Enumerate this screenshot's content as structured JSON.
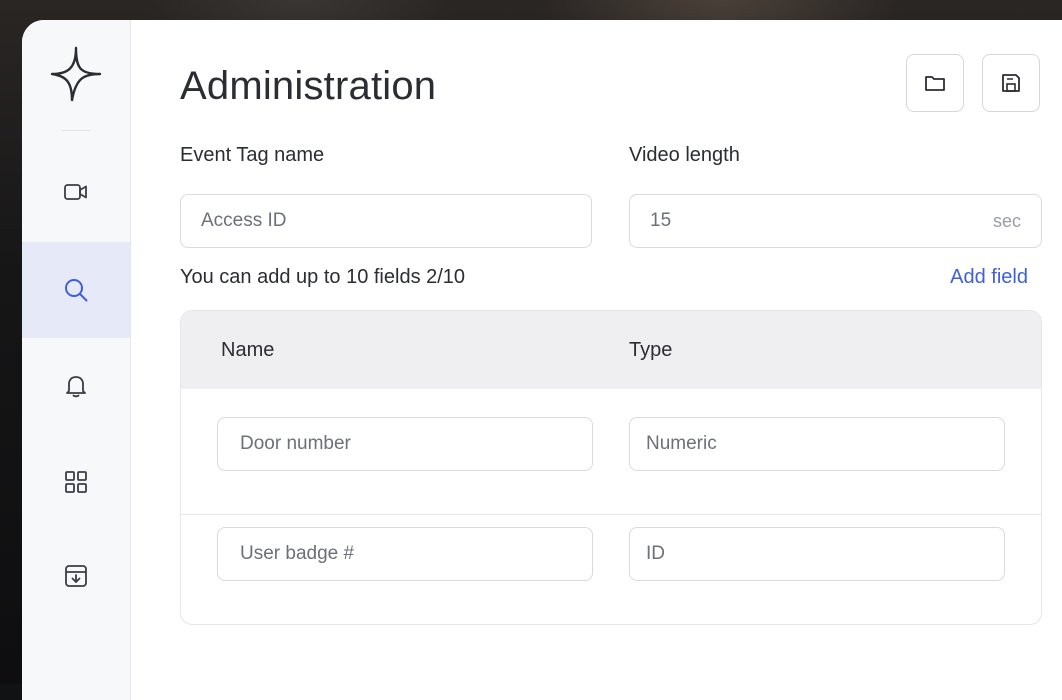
{
  "sidebar": {
    "logo_icon": "sparkle-logo",
    "items": [
      {
        "name": "camera",
        "icon": "video-camera-icon",
        "active": false
      },
      {
        "name": "search",
        "icon": "search-icon",
        "active": true
      },
      {
        "name": "alerts",
        "icon": "bell-icon",
        "active": false
      },
      {
        "name": "dashboard",
        "icon": "grid-icon",
        "active": false
      },
      {
        "name": "archive",
        "icon": "archive-download-icon",
        "active": false
      }
    ],
    "active_color": "#e6e9f8"
  },
  "header": {
    "title": "Administration",
    "actions": [
      {
        "name": "open",
        "icon": "folder-icon"
      },
      {
        "name": "save",
        "icon": "save-icon"
      }
    ]
  },
  "form": {
    "event_tag_label": "Event Tag name",
    "event_tag_placeholder": "Access ID",
    "video_length_label": "Video length",
    "video_length_value": "15",
    "video_length_unit": "sec"
  },
  "fields": {
    "hint": "You can add up to 10 fields 2/10",
    "add_label": "Add field",
    "columns": [
      "Name",
      "Type"
    ],
    "rows": [
      {
        "name": "Door number",
        "type": "Numeric"
      },
      {
        "name": "User badge #",
        "type": "ID"
      }
    ]
  },
  "colors": {
    "accent": "#3f5fe0",
    "text": "#2b2d33"
  }
}
